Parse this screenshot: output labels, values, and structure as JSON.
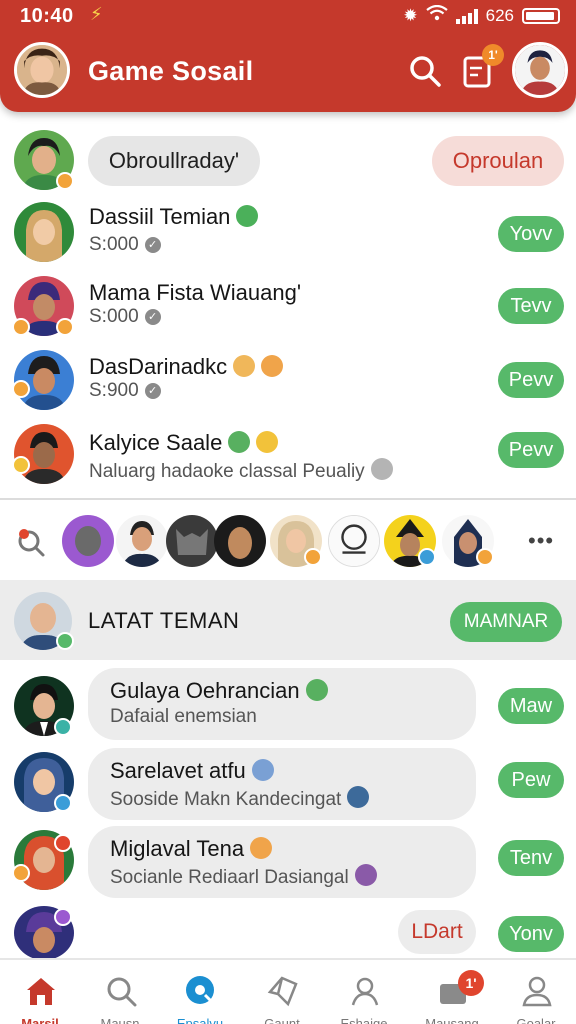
{
  "status_bar": {
    "time": "10:40",
    "battery": "626"
  },
  "header": {
    "title": "Game Sosail",
    "notification_badge": "1'"
  },
  "top_row": {
    "chip_label": "Obroullraday'",
    "action_label": "Oproulan"
  },
  "friends": [
    {
      "name": "Dassiil Temian",
      "sub": "S:000",
      "button": "Yovv"
    },
    {
      "name": "Mama Fista Wiauang'",
      "sub": "S:000",
      "button": "Tevv"
    },
    {
      "name": "DasDarinadkc",
      "sub": "S:900",
      "button": "Pevv"
    },
    {
      "name": "Kalyice Saale",
      "sub": "Naluarg hadaoke classal Peualiy",
      "button": "Pevv"
    }
  ],
  "strip": {
    "more_label": "•••"
  },
  "section": {
    "title": "LATAT TEMAN",
    "button": "MAMNAR"
  },
  "suggestions": [
    {
      "name": "Gulaya Oehrancian",
      "sub": "Dafaial enemsian",
      "button": "Maw"
    },
    {
      "name": "Sarelavet atfu",
      "sub": "Sooside Makn Kandecingat",
      "button": "Pew"
    },
    {
      "name": "Miglaval Tena",
      "sub": "Socianle Rediaarl Dasiangal",
      "button": "Tenv"
    }
  ],
  "last_row": {
    "chip_label": "LDart",
    "button": "Yonv"
  },
  "tabs": [
    {
      "label": "Marsil",
      "icon": "home-icon",
      "active": true,
      "color": "#c5392c"
    },
    {
      "label": "Mausn",
      "icon": "search-icon",
      "active": false
    },
    {
      "label": "Epsalvu",
      "icon": "discover-icon",
      "active": false,
      "color": "#1b8fd1"
    },
    {
      "label": "Gaunt",
      "icon": "game-icon",
      "active": false
    },
    {
      "label": "Eshaige",
      "icon": "people-icon",
      "active": false
    },
    {
      "label": "Mausang",
      "icon": "chat-icon",
      "active": false,
      "badge": "1'"
    },
    {
      "label": "Goalar",
      "icon": "profile-icon",
      "active": false
    }
  ],
  "colors": {
    "brand": "#c5392c",
    "accent_green": "#57b96a",
    "accent_blue": "#1b8fd1"
  }
}
